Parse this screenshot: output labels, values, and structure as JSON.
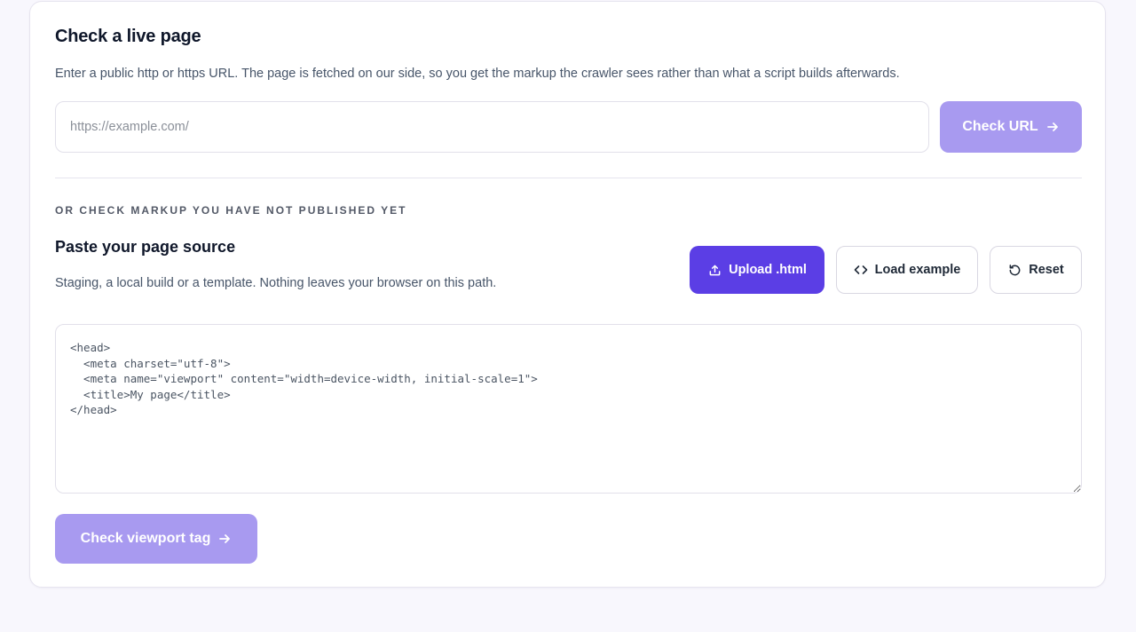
{
  "live_check": {
    "title": "Check a live page",
    "description": "Enter a public http or https URL. The page is fetched on our side, so you get the markup the crawler sees rather than what a script builds afterwards.",
    "url_placeholder": "https://example.com/",
    "url_value": "",
    "submit_label": "Check URL",
    "submit_icon": "arrow-right-icon"
  },
  "source_check": {
    "eyebrow": "OR CHECK MARKUP YOU HAVE NOT PUBLISHED YET",
    "title": "Paste your page source",
    "description": "Staging, a local build or a template. Nothing leaves your browser on this path.",
    "upload_label": "Upload .html",
    "upload_icon": "upload-icon",
    "load_example_label": "Load example",
    "load_example_icon": "code-brackets-icon",
    "reset_label": "Reset",
    "reset_icon": "reset-icon",
    "source_value": "<head>\n  <meta charset=\"utf-8\">\n  <meta name=\"viewport\" content=\"width=device-width, initial-scale=1\">\n  <title>My page</title>\n</head>",
    "submit_label": "Check viewport tag",
    "submit_icon": "arrow-right-icon"
  },
  "colors": {
    "accent": "#5b3ee5",
    "accent_disabled": "#a89af0",
    "page_background": "#f8f7fd",
    "card_border": "#e6e4ef"
  }
}
